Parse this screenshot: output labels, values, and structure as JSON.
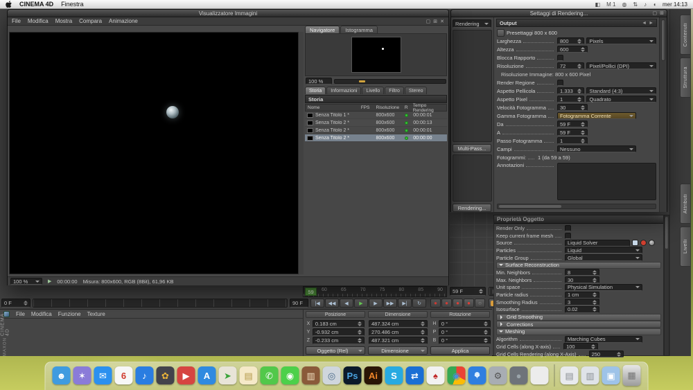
{
  "menubar": {
    "app": "CINEMA 4D",
    "menu1": "Finestra",
    "status": [
      {
        "t": "◧"
      },
      {
        "t": "M 1"
      },
      {
        "t": "◍"
      },
      {
        "t": "⇅"
      },
      {
        "t": "♪"
      },
      {
        "t": "◖"
      }
    ],
    "clock": "mer 14:13"
  },
  "picture_viewer": {
    "title": "Visualizzatore Immagini",
    "menus": [
      {
        "t": "File"
      },
      {
        "t": "Modifica"
      },
      {
        "t": "Mostra"
      },
      {
        "t": "Compara"
      },
      {
        "t": "Animazione"
      }
    ],
    "pv_icons": [
      {
        "t": "▢"
      },
      {
        "t": "⊞"
      },
      {
        "t": "✕"
      }
    ],
    "nav_tabs": [
      {
        "t": "Navigatore",
        "cls": "sel"
      },
      {
        "t": "Istogramma"
      }
    ],
    "zoom_value": "100 %",
    "info_tabs": [
      {
        "t": "Storia",
        "cls": "sel"
      },
      {
        "t": "Informazioni"
      },
      {
        "t": "Livello"
      },
      {
        "t": "Filtro"
      },
      {
        "t": "Stereo"
      }
    ],
    "history_title": "Storia",
    "col_nome": "Nome",
    "col_fps": "FPS",
    "col_ris": "Risoluzione",
    "col_r": "R",
    "col_tempo": "Tempo Rendering",
    "rows": [
      {
        "name": "Senza Titolo 1 *",
        "res": "800x600",
        "time": "00:00:01"
      },
      {
        "name": "Senza Titolo 2 *",
        "res": "800x600",
        "time": "00:00:13"
      },
      {
        "name": "Senza Titolo 2 *",
        "res": "800x600",
        "time": "00:00:01"
      },
      {
        "name": "Senza Titolo 2 *",
        "res": "800x600",
        "time": "00:00:00"
      }
    ],
    "status_zoom": "100 %",
    "status_play": "▶",
    "status_time": "00:00:00",
    "status_info": "Misura: 800x600, RGB (8Bit), 61,96 KB"
  },
  "render_settings": {
    "title": "Settaggi di Rendering...",
    "rs_icons": [
      {
        "t": "▢"
      },
      {
        "t": "⊞"
      }
    ],
    "renderer": "Rendering",
    "multipass": "Multi-Pass...",
    "render_btn": "Rendering...",
    "out": {
      "header": "Output",
      "hdr_l": "◄",
      "hdr_r": "►",
      "preset": "Presettaggi 800 x 600",
      "l_width": "Larghezza",
      "v_width": "800",
      "u_width": "Pixels",
      "l_height": "Altezza",
      "v_height": "600",
      "l_lock": "Blocca Rapporto",
      "l_res": "Risoluzione",
      "v_res": "72",
      "u_res": "Pixel/Pollici (DPI)",
      "img_res": "Risoluzione Immagine: 800 x 600 Pixel",
      "l_region": "Render Regione",
      "l_film": "Aspetto Pellicola",
      "v_film": "1.333",
      "u_film": "Standard (4:3)",
      "l_pixel": "Aspetto Pixel",
      "v_pixel": "1",
      "u_pixel": "Quadrato",
      "l_fps": "Velocità Fotogramma",
      "v_fps": "30",
      "l_range": "Gamma Fotogramma",
      "v_range": "Fotogramma Corrente",
      "l_from": "Da",
      "v_from": "59 F",
      "l_to": "A",
      "v_to": "59 F",
      "l_step": "Passo Fotogramma",
      "v_step": "1",
      "l_fields": "Campi",
      "v_fields": "Nessuno",
      "l_frames": "Fotogrammi:",
      "v_frames": "1 (da 59 a 59)",
      "l_annot": "Annotazioni"
    }
  },
  "attributes": {
    "title": "Proprietà Oggetto",
    "l_render_only": "Render Only",
    "l_keep": "Keep current frame mesh",
    "l_source": "Source",
    "v_source": "Liquid Solver",
    "l_particles": "Particles",
    "v_particles": "Liquid",
    "l_group": "Particle Group",
    "v_group": "Global",
    "sec_surface": "Surface Reconstruction",
    "l_min": "Min. Neighbors",
    "v_min": "8",
    "l_max": "Max. Neighbors",
    "v_max": "30",
    "l_unit": "Unit space",
    "v_unit": "Physical Simulation",
    "l_radius": "Particle radius",
    "v_radius": "1 cm",
    "l_smooth": "Smoothing Radius",
    "v_smooth": "3",
    "l_iso": "Isosurface",
    "v_iso": "0.02",
    "sec_grid": "Grid Smoothing",
    "sec_corr": "Corrections",
    "sec_mesh": "Meshing",
    "l_algo": "Algorithm",
    "v_algo": "Marching Cubes",
    "l_cells": "Grid Cells (along X-axis)",
    "v_cells": "100",
    "l_cells_r": "Grid Cells Rendering (along X-Axis)",
    "v_cells_r": "250"
  },
  "timeline": {
    "ruler_numbers": [
      {
        "t": "60"
      },
      {
        "t": "65"
      },
      {
        "t": "70"
      },
      {
        "t": "75"
      },
      {
        "t": "80"
      },
      {
        "t": "85"
      },
      {
        "t": "90"
      }
    ],
    "playhead": "59",
    "cur_frame": "59 F",
    "start": "0 F",
    "end": "90 F",
    "transport": [
      {
        "g": "|◀"
      },
      {
        "g": "◀◀"
      },
      {
        "g": "◀"
      },
      {
        "g": "▶",
        "cls": "play"
      },
      {
        "g": "▶"
      },
      {
        "g": "▶▶"
      },
      {
        "g": "▶|"
      },
      {
        "g": "↻"
      }
    ],
    "keys": [
      {
        "g": "●"
      },
      {
        "g": "●"
      },
      {
        "g": "●"
      },
      {
        "g": "●"
      },
      {
        "g": "○",
        "cls": "off"
      }
    ],
    "render_buttons": [
      {
        "c": "#d79b3b"
      },
      {
        "c": "#3fb08e"
      },
      {
        "c": "#4f86c6"
      },
      {
        "c": "#8b7bc8"
      }
    ]
  },
  "bottom": {
    "menus": [
      {
        "t": "File"
      },
      {
        "t": "Modifica"
      },
      {
        "t": "Funzione"
      },
      {
        "t": "Texture"
      }
    ],
    "logo_top": "MAXON",
    "logo": "CINEMA 4D"
  },
  "coords": {
    "h_pos": "Posizione",
    "h_dim": "Dimensione",
    "h_rot": "Rotazione",
    "rows": [
      {
        "a": "X",
        "pos": "0.183 cm",
        "dim": "487.324 cm",
        "rl": "H",
        "rot": "0 °"
      },
      {
        "a": "Y",
        "pos": "-0.932 cm",
        "dim": "270.486 cm",
        "rl": "P",
        "rot": "0 °"
      },
      {
        "a": "Z",
        "pos": "-0.233 cm",
        "dim": "487.321 cm",
        "rl": "B",
        "rot": "0 °"
      }
    ],
    "b_obj": "Oggetto (Rel)",
    "b_dim": "Dimensione",
    "b_apply": "Applica"
  },
  "side_tabs": {
    "top": [
      {
        "t": "Contenuti"
      },
      {
        "t": "Struttura"
      }
    ],
    "bottom": [
      {
        "t": "Attributi"
      },
      {
        "t": "Livelli"
      }
    ]
  },
  "dock": {
    "apps": [
      {
        "name": "finder",
        "bg": "#3f9be0",
        "glyph": "☻",
        "fg": "#ffffff"
      },
      {
        "name": "launchpad",
        "bg": "#8a7bd8",
        "glyph": "✶",
        "fg": "#ffffff"
      },
      {
        "name": "mail",
        "bg": "#2b90ef",
        "glyph": "✉",
        "fg": "#ffffff"
      },
      {
        "name": "calendar",
        "bg": "#f7f7f7",
        "glyph": "6",
        "fg": "#d03a2e"
      },
      {
        "name": "itunes",
        "bg": "#2a7de1",
        "glyph": "♪",
        "fg": "#ffffff"
      },
      {
        "name": "photos",
        "bg": "#43434b",
        "glyph": "✿",
        "fg": "#e8b23a"
      },
      {
        "name": "app-red",
        "bg": "#d64541",
        "glyph": "▶",
        "fg": "#ffffff"
      },
      {
        "name": "app-store",
        "bg": "#2f8ae0",
        "glyph": "A",
        "fg": "#ffffff"
      },
      {
        "name": "maps",
        "bg": "#e8e4d8",
        "glyph": "➤",
        "fg": "#3aa33a"
      },
      {
        "name": "notes",
        "bg": "#f5e9c8",
        "glyph": "▤",
        "fg": "#b59a4a"
      },
      {
        "name": "messages",
        "bg": "#52c84a",
        "glyph": "✆",
        "fg": "#ffffff"
      },
      {
        "name": "facetime",
        "bg": "#4cd04a",
        "glyph": "◉",
        "fg": "#ffffff"
      },
      {
        "name": "dictionary",
        "bg": "#8a5a3a",
        "glyph": "▥",
        "fg": "#f0e0c0"
      },
      {
        "name": "preview",
        "bg": "#cfd6dd",
        "glyph": "◎",
        "fg": "#4a6a8a"
      },
      {
        "name": "photoshop",
        "bg": "#0c1a2a",
        "glyph": "Ps",
        "fg": "#4aa3e0"
      },
      {
        "name": "illustrator",
        "bg": "#2a1505",
        "glyph": "Ai",
        "fg": "#f0862a"
      },
      {
        "name": "skype",
        "bg": "#27aae1",
        "glyph": "S",
        "fg": "#ffffff"
      },
      {
        "name": "teamviewer",
        "bg": "#1a6fd4",
        "glyph": "⇄",
        "fg": "#ffffff"
      },
      {
        "name": "solitaire",
        "bg": "#f2f2f2",
        "glyph": "♠",
        "fg": "#c02a2a"
      },
      {
        "name": "chrome",
        "cls": "i-chrome",
        "glyph": "◉",
        "fg": "#4a90d9"
      },
      {
        "name": "safari",
        "cls": "i-safari",
        "glyph": "✧",
        "fg": "#ffffff"
      },
      {
        "name": "system-preferences",
        "bg": "#a8adb3",
        "glyph": "⚙",
        "fg": "#555555"
      },
      {
        "name": "app-sphere",
        "bg": "#6e737a",
        "glyph": "●",
        "fg": "#9aa4aa"
      },
      {
        "name": "app-white",
        "bg": "#ececec",
        "glyph": "",
        "fg": "#888888"
      }
    ],
    "stacks": [
      {
        "name": "stack-documents",
        "bg": "#e8eaed",
        "glyph": "▤",
        "fg": "#8a8f94"
      },
      {
        "name": "stack-downloads",
        "bg": "#dfe3e8",
        "glyph": "▥",
        "fg": "#8a8f94"
      },
      {
        "name": "stack-folder",
        "bg": "#9ec3e8",
        "glyph": "▣",
        "fg": "#ffffff"
      }
    ],
    "trash_glyph": "▦"
  }
}
